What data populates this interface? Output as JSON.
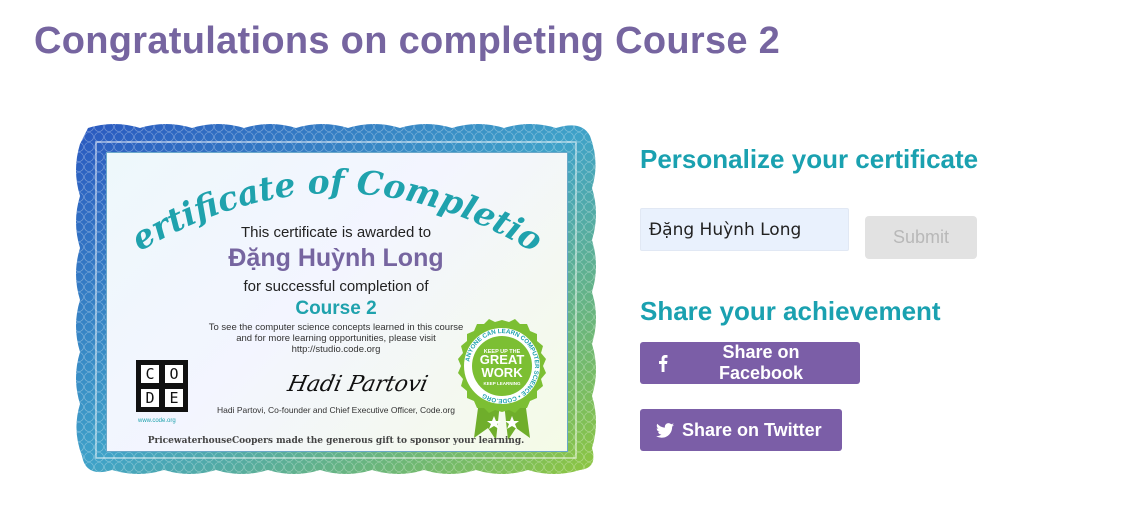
{
  "page": {
    "title": "Congratulations on completing Course 2"
  },
  "certificate": {
    "heading": "Certificate of Completion",
    "awarded_text": "This certificate is awarded to",
    "recipient": "Đặng Huỳnh Long",
    "completion_text": "for successful completion of",
    "course": "Course 2",
    "visit_line1": "To see the computer science concepts learned in this course",
    "visit_line2": "and for more learning opportunities, please visit",
    "visit_url": "http://studio.code.org",
    "signature": "Hadi Partovi",
    "signer": "Hadi Partovi, Co-founder and Chief Executive Officer, Code.org",
    "sponsor": "PricewaterhouseCoopers made the generous gift to sponsor your learning.",
    "logo_letters": [
      "C",
      "O",
      "D",
      "E"
    ],
    "logo_url": "www.code.org",
    "badge": {
      "ring_text": "ANYONE CAN LEARN COMPUTER SCIENCE • CODE.ORG",
      "top_text": "KEEP UP THE",
      "main_line1": "GREAT",
      "main_line2": "WORK",
      "bottom_text": "KEEP LEARNING"
    },
    "colors": {
      "frame_blue": "#2f6cc4",
      "frame_green": "#8cc43c",
      "heading_teal": "#1fa2ad"
    }
  },
  "personalize": {
    "title": "Personalize your certificate",
    "name_value": "Đặng Huỳnh Long",
    "submit_label": "Submit"
  },
  "share": {
    "title": "Share your achievement",
    "facebook_label": "Share on Facebook",
    "twitter_label": "Share on Twitter",
    "facebook_icon": "facebook-icon",
    "twitter_icon": "twitter-icon"
  },
  "colors": {
    "title_purple": "#7665a0",
    "accent_teal": "#1aa1b0",
    "button_purple": "#7b5ea7",
    "input_bg": "#e9f1fd"
  }
}
